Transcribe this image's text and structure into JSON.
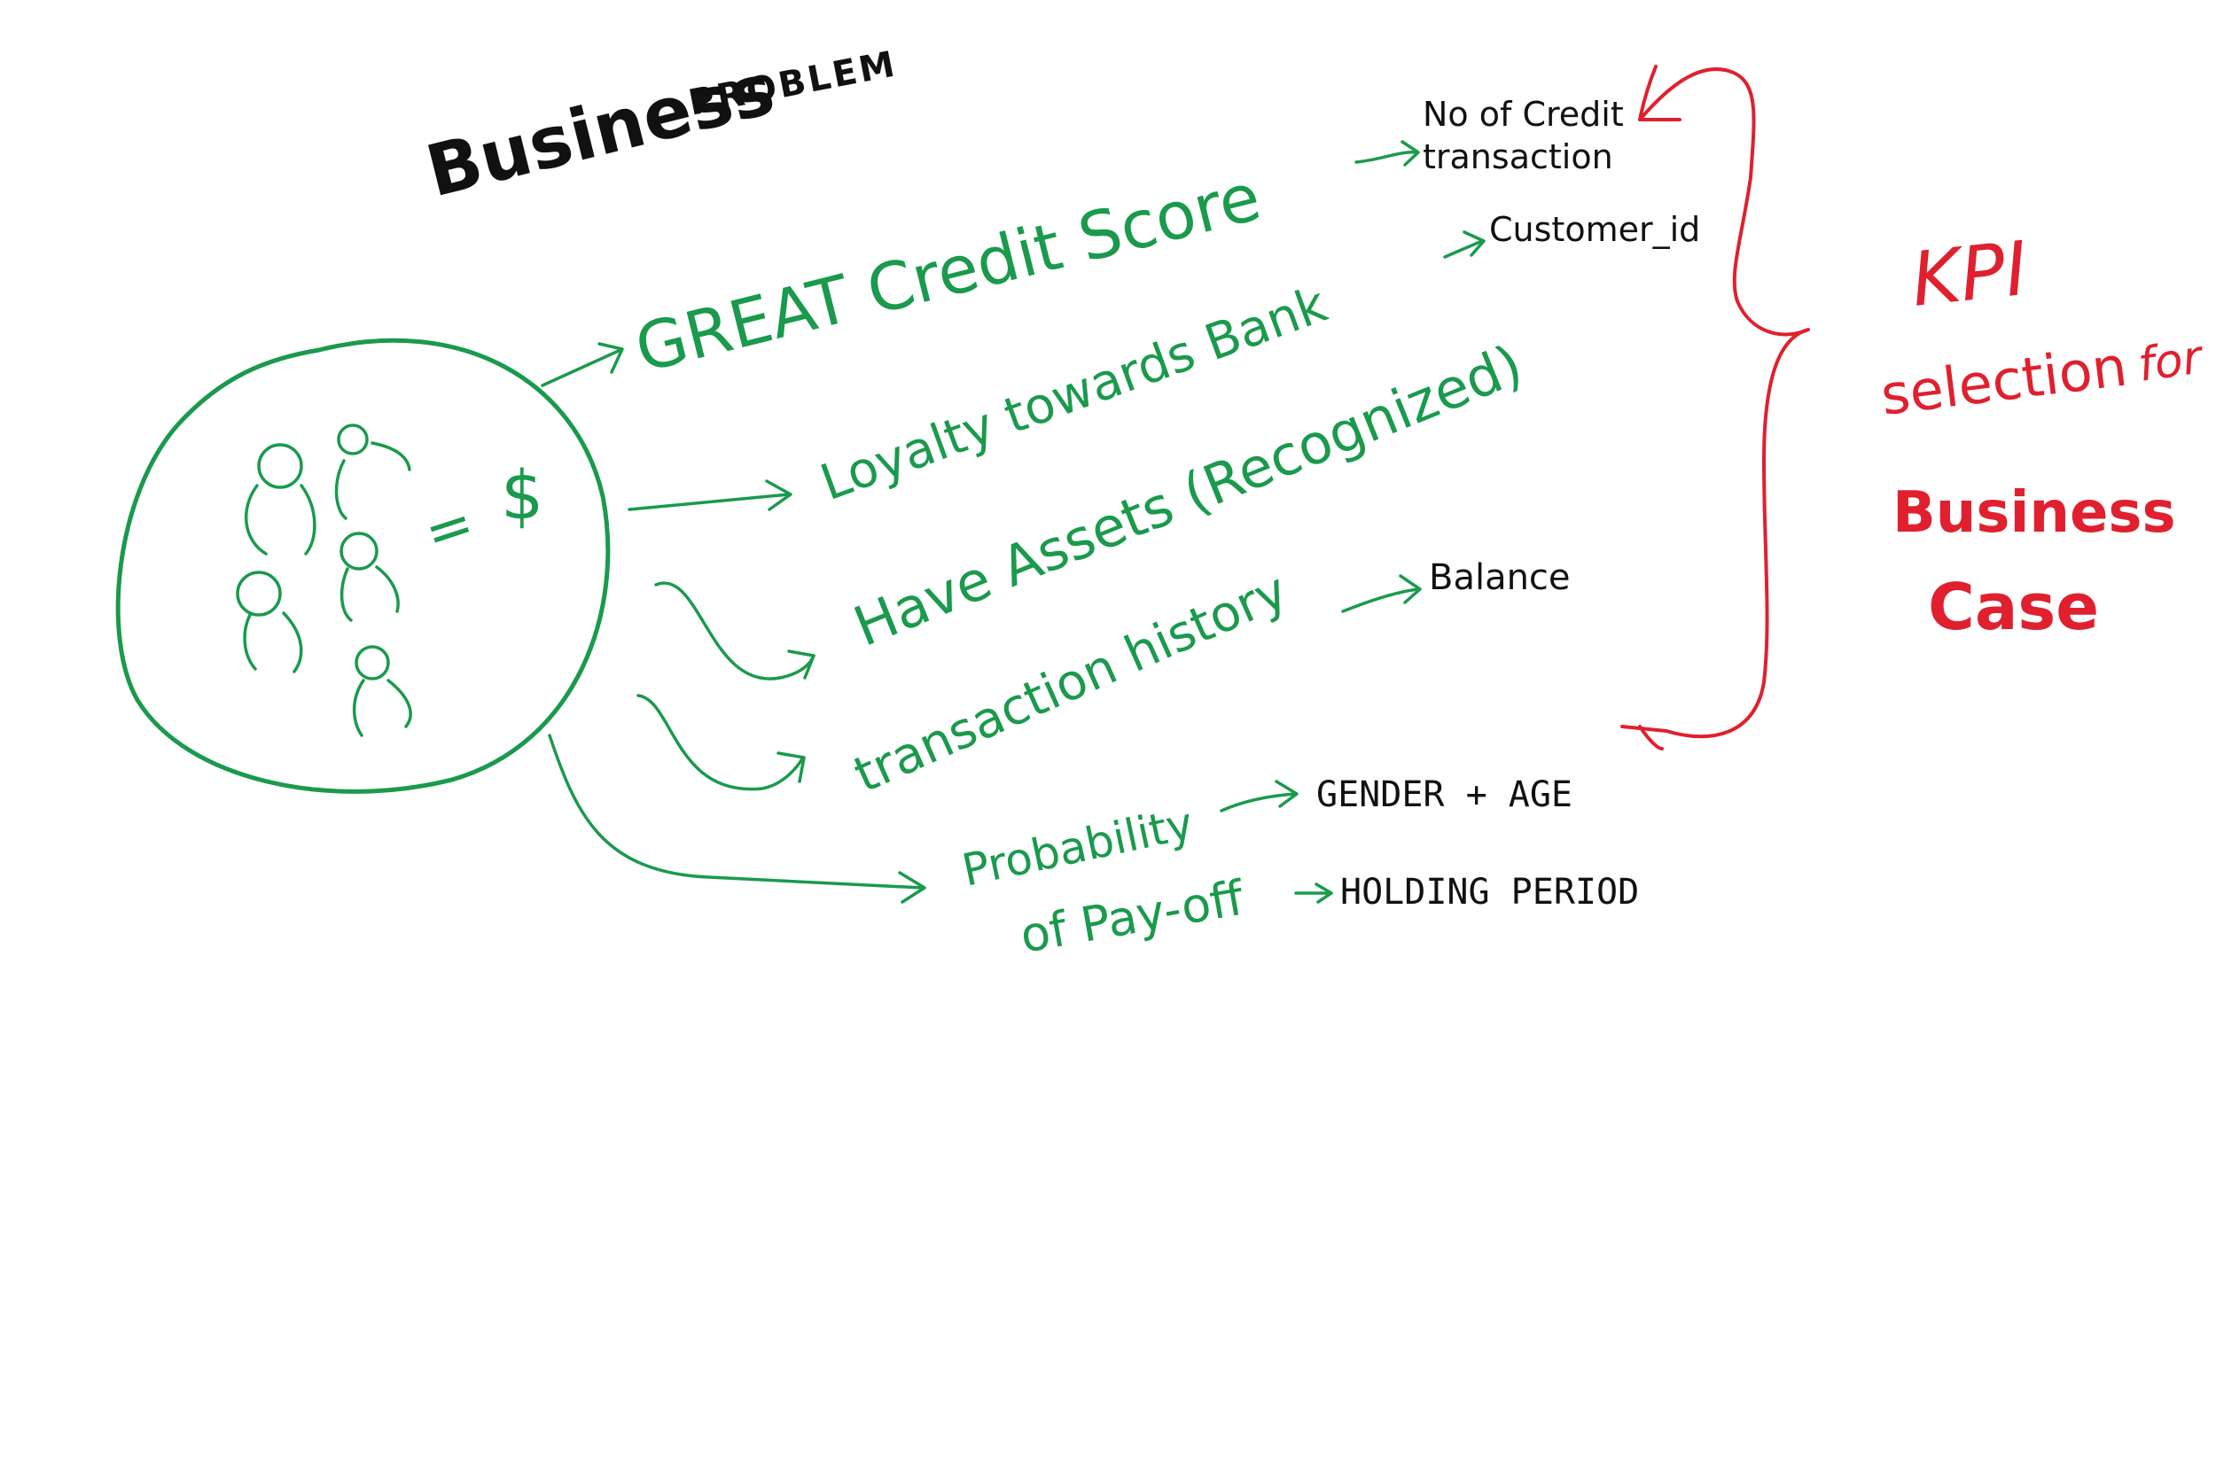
{
  "title": {
    "main": "Business",
    "sub": "PROBLEM"
  },
  "customers": {
    "equals_sign": "=",
    "dollar_sign": "$"
  },
  "branches": {
    "credit_score": "GREAT Credit Score",
    "loyalty": "Loyalty towards Bank",
    "assets": "Have Assets (Recognized)",
    "transaction_history": "transaction history",
    "probability_line1": "Probability",
    "probability_line2": "of Pay-off"
  },
  "kpis": {
    "credit_transactions_line1": "No of Credit",
    "credit_transactions_line2": "transaction",
    "customer_id": "Customer_id",
    "balance": "Balance",
    "gender_age": "GENDER + AGE",
    "holding_period": "HOLDING PERIOD"
  },
  "kpi_selection": {
    "line1": "KPI",
    "line2": "selection",
    "line3": "for",
    "line4": "Business",
    "line5": "Case"
  },
  "colors": {
    "green": "#1a9a4c",
    "red": "#e0202e",
    "black": "#111111"
  }
}
